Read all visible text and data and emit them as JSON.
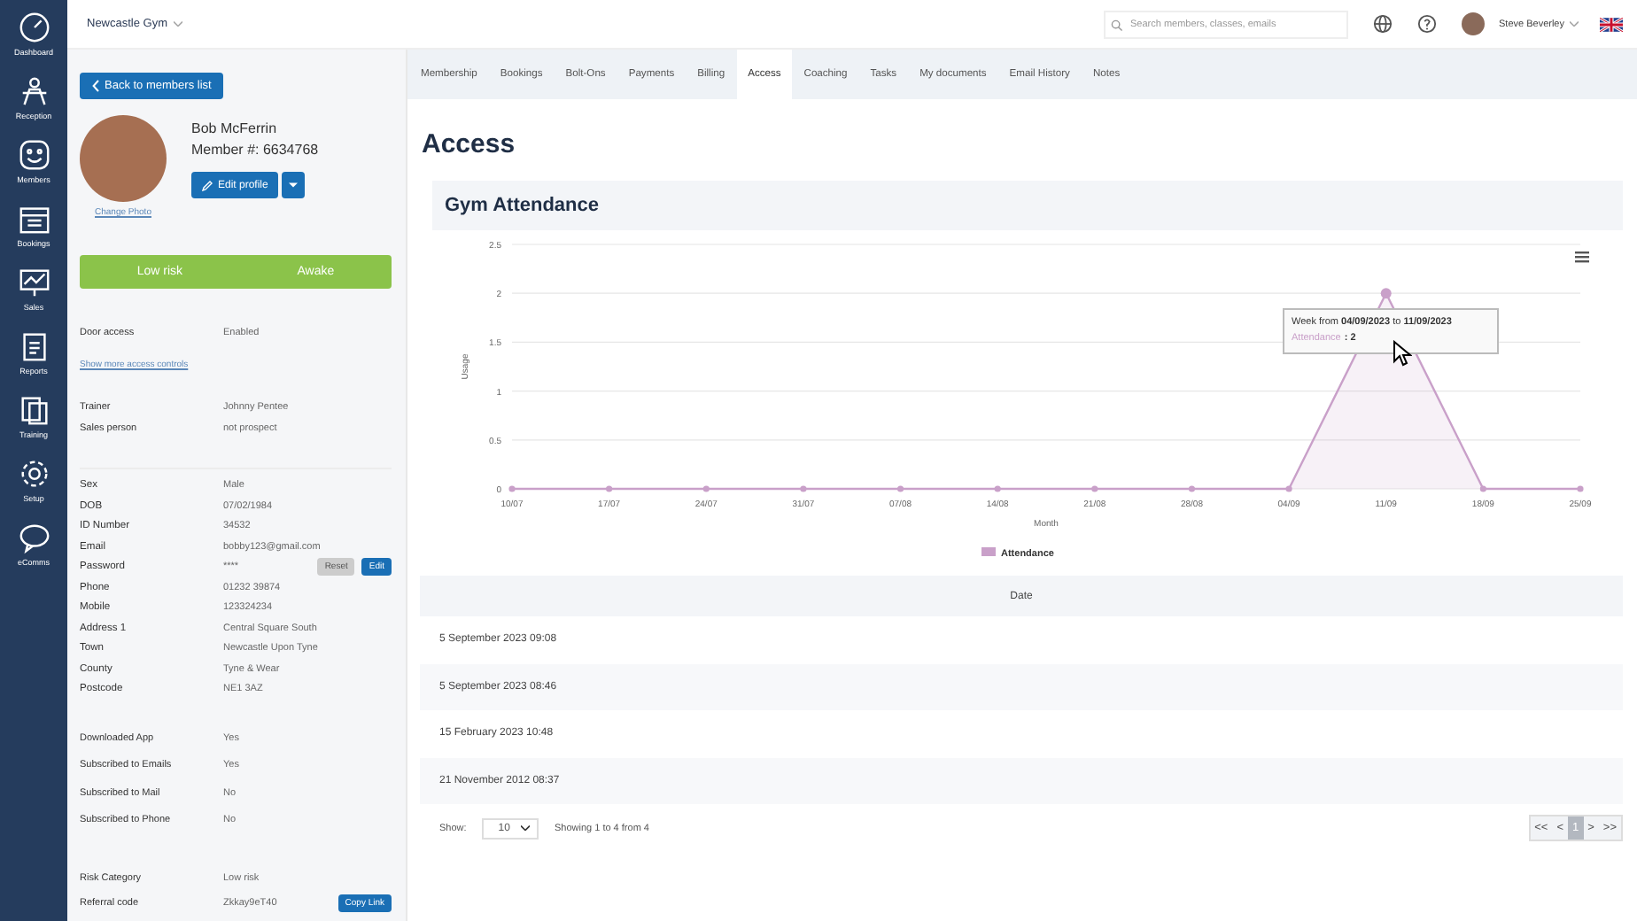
{
  "nav": {
    "items": [
      {
        "label": "Dashboard"
      },
      {
        "label": "Reception"
      },
      {
        "label": "Members"
      },
      {
        "label": "Bookings"
      },
      {
        "label": "Sales"
      },
      {
        "label": "Reports"
      },
      {
        "label": "Training"
      },
      {
        "label": "Setup"
      },
      {
        "label": "eComms"
      }
    ]
  },
  "topbar": {
    "gym": "Newcastle Gym",
    "search": {
      "placeholder": "Search members, classes, emails"
    },
    "user": "Steve Beverley"
  },
  "member": {
    "back": "Back to members list",
    "name": "Bob McFerrin",
    "number": "Member #: 6634768",
    "edit": "Edit profile",
    "change_photo": "Change Photo",
    "risk": "Low risk",
    "status": "Awake",
    "door": {
      "label": "Door access",
      "value": "Enabled"
    },
    "more": "Show more access controls",
    "staff": [
      {
        "label": "Trainer",
        "value": "Johnny Pentee"
      },
      {
        "label": "Sales person",
        "value": "not prospect"
      }
    ],
    "details": [
      {
        "label": "Sex",
        "value": "Male"
      },
      {
        "label": "DOB",
        "value": "07/02/1984"
      },
      {
        "label": "ID Number",
        "value": "34532"
      },
      {
        "label": "Email",
        "value": "bobby123@gmail.com"
      },
      {
        "label": "Password",
        "value": "****",
        "buttons": [
          "Reset",
          "Edit"
        ]
      },
      {
        "label": "Phone",
        "value": "01232 39874"
      },
      {
        "label": "Mobile",
        "value": "123324234"
      },
      {
        "label": "Address 1",
        "value": "Central Square South"
      },
      {
        "label": "Town",
        "value": "Newcastle Upon Tyne"
      },
      {
        "label": "County",
        "value": "Tyne & Wear"
      },
      {
        "label": "Postcode",
        "value": "NE1 3AZ"
      }
    ],
    "prefs": [
      {
        "label": "Downloaded App",
        "value": "Yes"
      },
      {
        "label": "Subscribed to Emails",
        "value": "Yes"
      },
      {
        "label": "Subscribed to Mail",
        "value": "No"
      },
      {
        "label": "Subscribed to Phone",
        "value": "No"
      }
    ],
    "extra": [
      {
        "label": "Risk Category",
        "value": "Low risk"
      },
      {
        "label": "Referral code",
        "value": "Zkkay9eT40",
        "button": "Copy Link"
      }
    ]
  },
  "tabs": [
    {
      "label": "Membership",
      "selected": false
    },
    {
      "label": "Bookings",
      "selected": false
    },
    {
      "label": "Bolt-Ons",
      "selected": false
    },
    {
      "label": "Payments",
      "selected": false
    },
    {
      "label": "Billing",
      "selected": false
    },
    {
      "label": "Access",
      "selected": true
    },
    {
      "label": "Coaching",
      "selected": false
    },
    {
      "label": "Tasks",
      "selected": false
    },
    {
      "label": "My documents",
      "selected": false
    },
    {
      "label": "Email History",
      "selected": false
    },
    {
      "label": "Notes",
      "selected": false
    }
  ],
  "page_title": "Access",
  "attendance": {
    "title": "Gym Attendance",
    "chart_data": {
      "type": "area",
      "xlabel": "Month",
      "ylabel": "Usage",
      "categories": [
        "10/07",
        "17/07",
        "24/07",
        "31/07",
        "07/08",
        "14/08",
        "21/08",
        "28/08",
        "04/09",
        "11/09",
        "18/09",
        "25/09"
      ],
      "series": [
        {
          "name": "Attendance",
          "color": "#c9a0c9",
          "values": [
            0,
            0,
            0,
            0,
            0,
            0,
            0,
            0,
            0,
            2,
            0,
            0
          ]
        }
      ],
      "ylim": [
        0,
        2.5
      ],
      "grid": true,
      "yticks": [
        0,
        0.5,
        1,
        1.5,
        2,
        2.5
      ]
    },
    "tooltip": {
      "heading": "Week from **04/09/2023** to **11/09/2023**",
      "series": "Attendance",
      "value": ": 2"
    }
  },
  "table": {
    "columns": [
      "Date"
    ],
    "rows": [
      [
        "5 September 2023 09:08"
      ],
      [
        "5 September 2023 08:46"
      ],
      [
        "15 February 2023 10:48"
      ],
      [
        "21 November 2012 08:37"
      ]
    ],
    "show_label": "Show:",
    "page_size": "10",
    "summary": "Showing 1 to 4 from 4",
    "pager": [
      {
        "label": "<<",
        "selected": false
      },
      {
        "label": "<",
        "selected": false
      },
      {
        "label": "1",
        "selected": true
      },
      {
        "label": ">",
        "selected": false
      },
      {
        "label": ">>",
        "selected": false
      }
    ]
  }
}
